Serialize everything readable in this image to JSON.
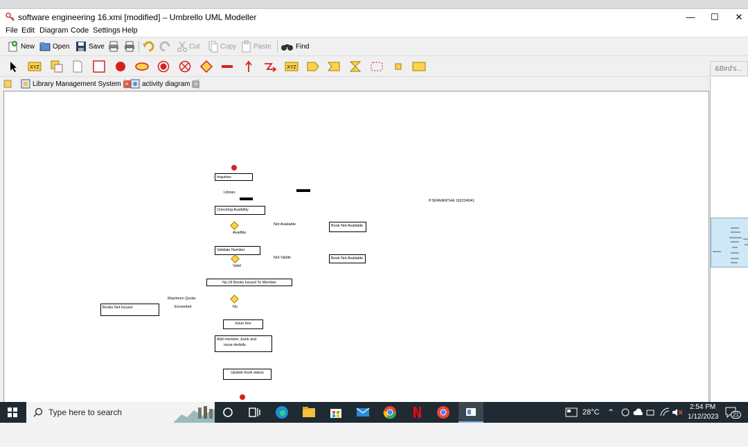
{
  "window": {
    "title": "software engineering 16.xmi [modified] – Umbrello UML Modeller",
    "minimize": "—",
    "maximize": "☐",
    "close": "✕"
  },
  "menu": [
    "File",
    "Edit",
    "Diagram",
    "Code",
    "Settings",
    "Help"
  ],
  "toolbar": {
    "new": "New",
    "open": "Open",
    "save": "Save",
    "cut": "Cut",
    "copy": "Copy",
    "paste": "Paste",
    "find": "Find"
  },
  "tabs": [
    {
      "label": "Library Management System"
    },
    {
      "label": "activity diagram"
    }
  ],
  "birds_eye": {
    "title": "&Bird's..."
  },
  "diagram": {
    "activities": [
      "Inquiries",
      "Checking Avaibility",
      "Book Not Available",
      "Validate Number",
      "Book Not Available",
      "No.Of Books Issued To Member",
      "Books Not Issued",
      "Issue box",
      "Add member ,book and",
      "issue dedails",
      "Update book status"
    ],
    "labels": [
      "Librian",
      "P.SRAVANTHA 192224041",
      "Not Available",
      "Availble",
      "Not Valide",
      "Valid",
      "Maximum Quota",
      "Exceeded",
      "No"
    ]
  },
  "taskbar": {
    "search_placeholder": "Type here to search",
    "weather": "28°C",
    "time": "2:54 PM",
    "date": "1/12/2023",
    "notification_count": "21"
  },
  "colors": {
    "taskbar_bg": "#1f2a33",
    "start_node": "#d62020",
    "decision": "#ffd24a",
    "tab_close": "#e0533f"
  }
}
